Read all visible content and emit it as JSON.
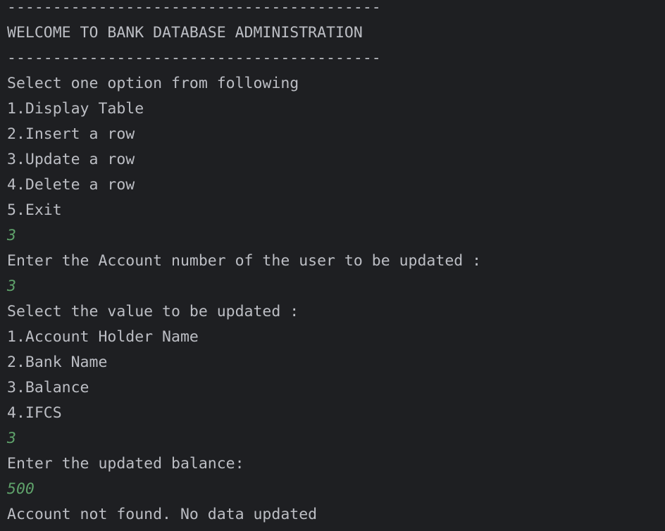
{
  "console": {
    "colors": {
      "background": "#1e1f22",
      "output_text": "#bcbec4",
      "input_text": "#5fa36b"
    },
    "lines": [
      {
        "text": "-----------------------------------------",
        "kind": "output"
      },
      {
        "text": "WELCOME TO BANK DATABASE ADMINISTRATION",
        "kind": "output"
      },
      {
        "text": "-----------------------------------------",
        "kind": "output"
      },
      {
        "text": "Select one option from following",
        "kind": "output"
      },
      {
        "text": "1.Display Table",
        "kind": "output"
      },
      {
        "text": "2.Insert a row",
        "kind": "output"
      },
      {
        "text": "3.Update a row",
        "kind": "output"
      },
      {
        "text": "4.Delete a row",
        "kind": "output"
      },
      {
        "text": "5.Exit",
        "kind": "output"
      },
      {
        "text": "3",
        "kind": "input"
      },
      {
        "text": "Enter the Account number of the user to be updated :",
        "kind": "output"
      },
      {
        "text": "3",
        "kind": "input"
      },
      {
        "text": "Select the value to be updated :",
        "kind": "output"
      },
      {
        "text": "1.Account Holder Name",
        "kind": "output"
      },
      {
        "text": "2.Bank Name",
        "kind": "output"
      },
      {
        "text": "3.Balance",
        "kind": "output"
      },
      {
        "text": "4.IFCS",
        "kind": "output"
      },
      {
        "text": "3",
        "kind": "input"
      },
      {
        "text": "Enter the updated balance:",
        "kind": "output"
      },
      {
        "text": "500",
        "kind": "input"
      },
      {
        "text": "Account not found. No data updated",
        "kind": "output"
      }
    ]
  }
}
